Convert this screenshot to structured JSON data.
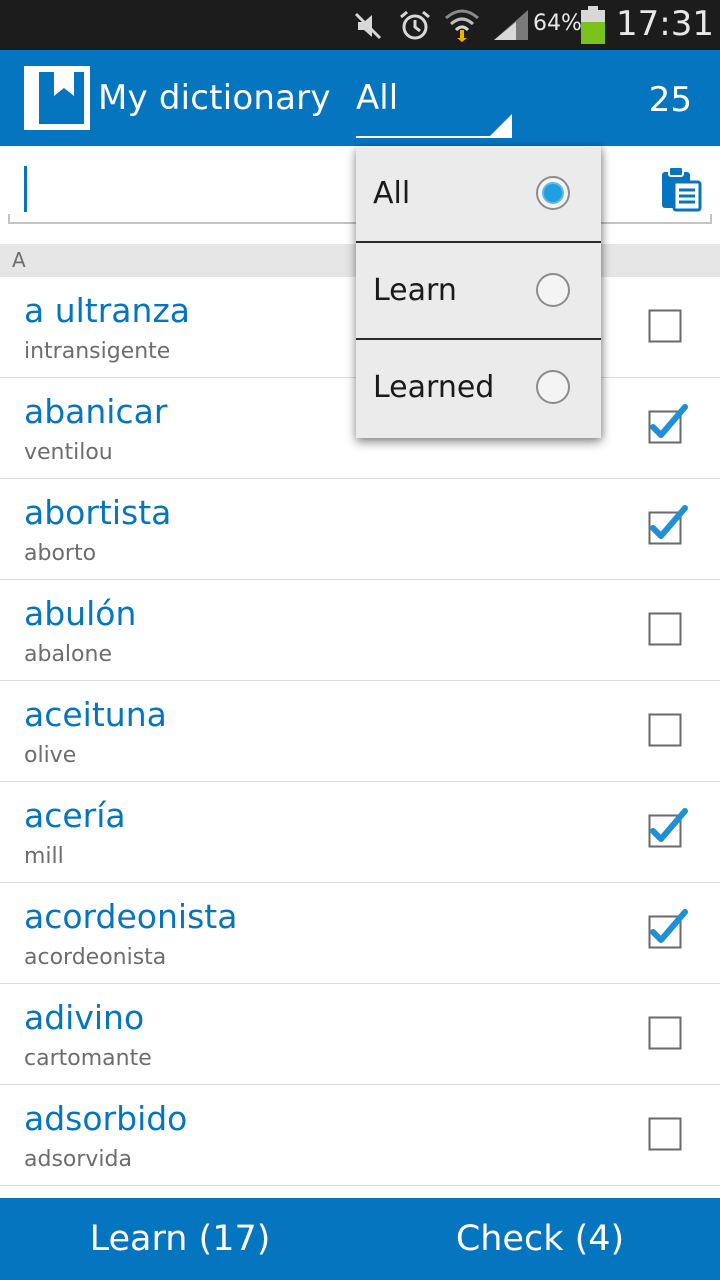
{
  "status_bar": {
    "icons": [
      "mute-icon",
      "alarm-icon",
      "wifi-icon",
      "signal-icon",
      "battery-icon"
    ],
    "battery_percent": "64%",
    "time": "17:31"
  },
  "app_bar": {
    "title": "My dictionary",
    "filter_value": "All",
    "count": "25",
    "colors": {
      "primary": "#0675c0",
      "status_bar": "#1c1c1c"
    }
  },
  "search": {
    "value": "",
    "placeholder": ""
  },
  "section": {
    "letter": "A"
  },
  "words": [
    {
      "term": "a ultranza",
      "translation": "intransigente",
      "learned": false
    },
    {
      "term": "abanicar",
      "translation": "ventilou",
      "learned": true
    },
    {
      "term": "abortista",
      "translation": "aborto",
      "learned": true
    },
    {
      "term": "abulón",
      "translation": "abalone",
      "learned": false
    },
    {
      "term": "aceituna",
      "translation": "olive",
      "learned": false
    },
    {
      "term": "acería",
      "translation": "mill",
      "learned": true
    },
    {
      "term": "acordeonista",
      "translation": "acordeonista",
      "learned": true
    },
    {
      "term": "adivino",
      "translation": "cartomante",
      "learned": false
    },
    {
      "term": "adsorbido",
      "translation": "adsorvida",
      "learned": false
    }
  ],
  "filter_dropdown": {
    "options": [
      {
        "label": "All",
        "selected": true
      },
      {
        "label": "Learn",
        "selected": false
      },
      {
        "label": "Learned",
        "selected": false
      }
    ]
  },
  "bottom_bar": {
    "learn_label": "Learn (17)",
    "check_label": "Check (4)"
  }
}
